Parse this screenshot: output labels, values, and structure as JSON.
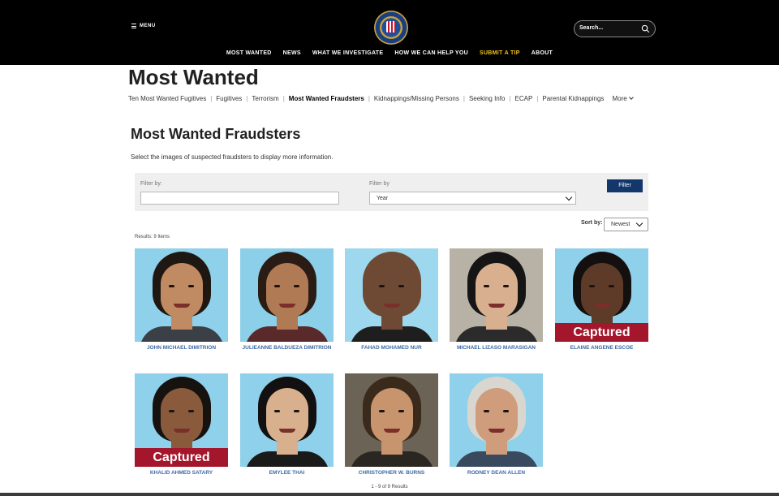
{
  "header": {
    "menu_label": "MENU",
    "search_placeholder": "Search...",
    "nav": [
      "MOST WANTED",
      "NEWS",
      "WHAT WE INVESTIGATE",
      "HOW WE CAN HELP YOU",
      "SUBMIT A TIP",
      "ABOUT"
    ]
  },
  "page": {
    "title": "Most Wanted",
    "subnav": [
      "Ten Most Wanted Fugitives",
      "Fugitives",
      "Terrorism",
      "Most Wanted Fraudsters",
      "Kidnappings/Missing Persons",
      "Seeking Info",
      "ECAP",
      "Parental Kidnappings",
      "More"
    ],
    "subnav_active": "Most Wanted Fraudsters",
    "section_title": "Most Wanted Fraudsters",
    "section_desc": "Select the images of suspected fraudsters to display more information."
  },
  "filter": {
    "label1": "Filter by:",
    "value1": "",
    "label2": "Filter by",
    "select_value": "Year",
    "button": "Filter"
  },
  "sort": {
    "label": "Sort by:",
    "value": "Newest"
  },
  "results_text": "Results: 9 Items",
  "pagination_text": "1 - 9 of 9 Results",
  "captured_label": "Captured",
  "people": [
    {
      "name": "JOHN MICHAEL DIMITRION",
      "captured": false,
      "bg": "#8fd0ea",
      "skin": "#c08a62",
      "hair": "#1f1712",
      "shirt": "#3b3f46"
    },
    {
      "name": "JULIEANNE BALDUEZA DIMITRION",
      "captured": false,
      "bg": "#8ccfe8",
      "skin": "#b07a55",
      "hair": "#2a1c14",
      "shirt": "#5a2a2a"
    },
    {
      "name": "FAHAD MOHAMED NUR",
      "captured": false,
      "bg": "#9ed8ee",
      "skin": "#6e4a34",
      "hair": "#6e4a34",
      "shirt": "#1e1e1e"
    },
    {
      "name": "MICHAEL LIZASO MARASIGAN",
      "captured": false,
      "bg": "#b7b2a5",
      "skin": "#d8b08f",
      "hair": "#151515",
      "shirt": "#2b2b2b"
    },
    {
      "name": "ELAINE ANGENE ESCOE",
      "captured": true,
      "bg": "#8fd0ea",
      "skin": "#5d3b28",
      "hair": "#141010",
      "shirt": "#2a2a35"
    },
    {
      "name": "KHALID AHMED SATARY",
      "captured": true,
      "bg": "#8fd0ea",
      "skin": "#8a5a3c",
      "hair": "#151210",
      "shirt": "#4a4a52"
    },
    {
      "name": "EMYLEE THAI",
      "captured": false,
      "bg": "#8fd0ea",
      "skin": "#d9b08e",
      "hair": "#121010",
      "shirt": "#1a1a1a"
    },
    {
      "name": "CHRISTOPHER W. BURNS",
      "captured": false,
      "bg": "#6b6355",
      "skin": "#c8946e",
      "hair": "#3a2a1c",
      "shirt": "#2a2622"
    },
    {
      "name": "RODNEY DEAN ALLEN",
      "captured": false,
      "bg": "#8fd0ea",
      "skin": "#cf9c7c",
      "hair": "#d9d6d0",
      "shirt": "#3a4a5e"
    }
  ]
}
